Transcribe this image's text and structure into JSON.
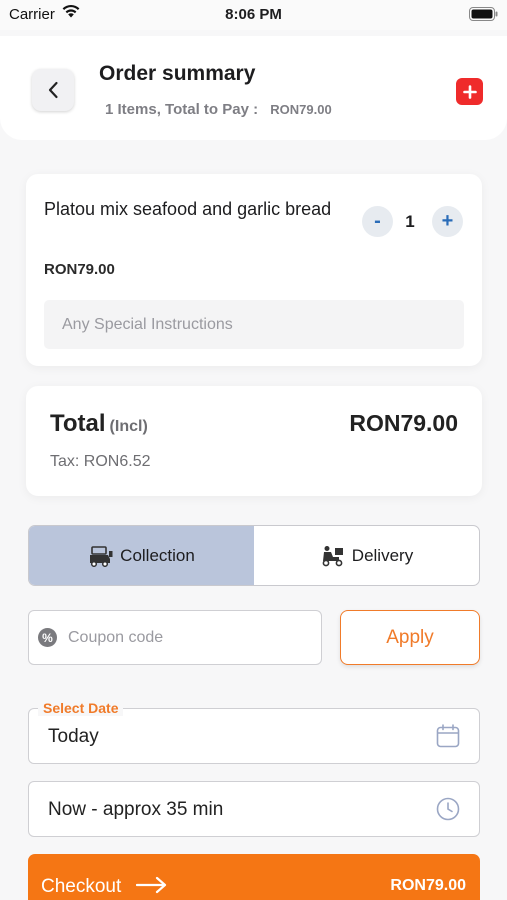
{
  "status_bar": {
    "carrier": "Carrier",
    "time": "8:06 PM"
  },
  "header": {
    "title": "Order summary",
    "items_count": "1",
    "items_text": "Items, Total to Pay :",
    "total": "RON79.00"
  },
  "cart_item": {
    "name": "Platou mix seafood and garlic bread",
    "price": "RON79.00",
    "quantity": "1",
    "minus_label": "-",
    "plus_label": "+",
    "instructions_placeholder": "Any Special Instructions"
  },
  "totals": {
    "label": "Total",
    "incl": "(Incl)",
    "amount": "RON79.00",
    "tax": "Tax: RON6.52"
  },
  "order_type": {
    "options": [
      {
        "label": "Collection",
        "icon": "collection-icon",
        "active": true
      },
      {
        "label": "Delivery",
        "icon": "delivery-icon",
        "active": false
      }
    ]
  },
  "coupon": {
    "placeholder": "Coupon code",
    "icon": "percent-badge-icon",
    "apply_label": "Apply"
  },
  "date_field": {
    "label": "Select Date",
    "value": "Today",
    "icon": "calendar-icon"
  },
  "time_field": {
    "value": "Now - approx 35 min",
    "icon": "clock-icon"
  },
  "checkout": {
    "label": "Checkout",
    "amount": "RON79.00",
    "icon": "arrow-right-icon"
  },
  "colors": {
    "accent": "#f57614",
    "danger": "#ef2b2b",
    "toggle_active": "#bac5db",
    "stepper": "#2a6cb8"
  }
}
